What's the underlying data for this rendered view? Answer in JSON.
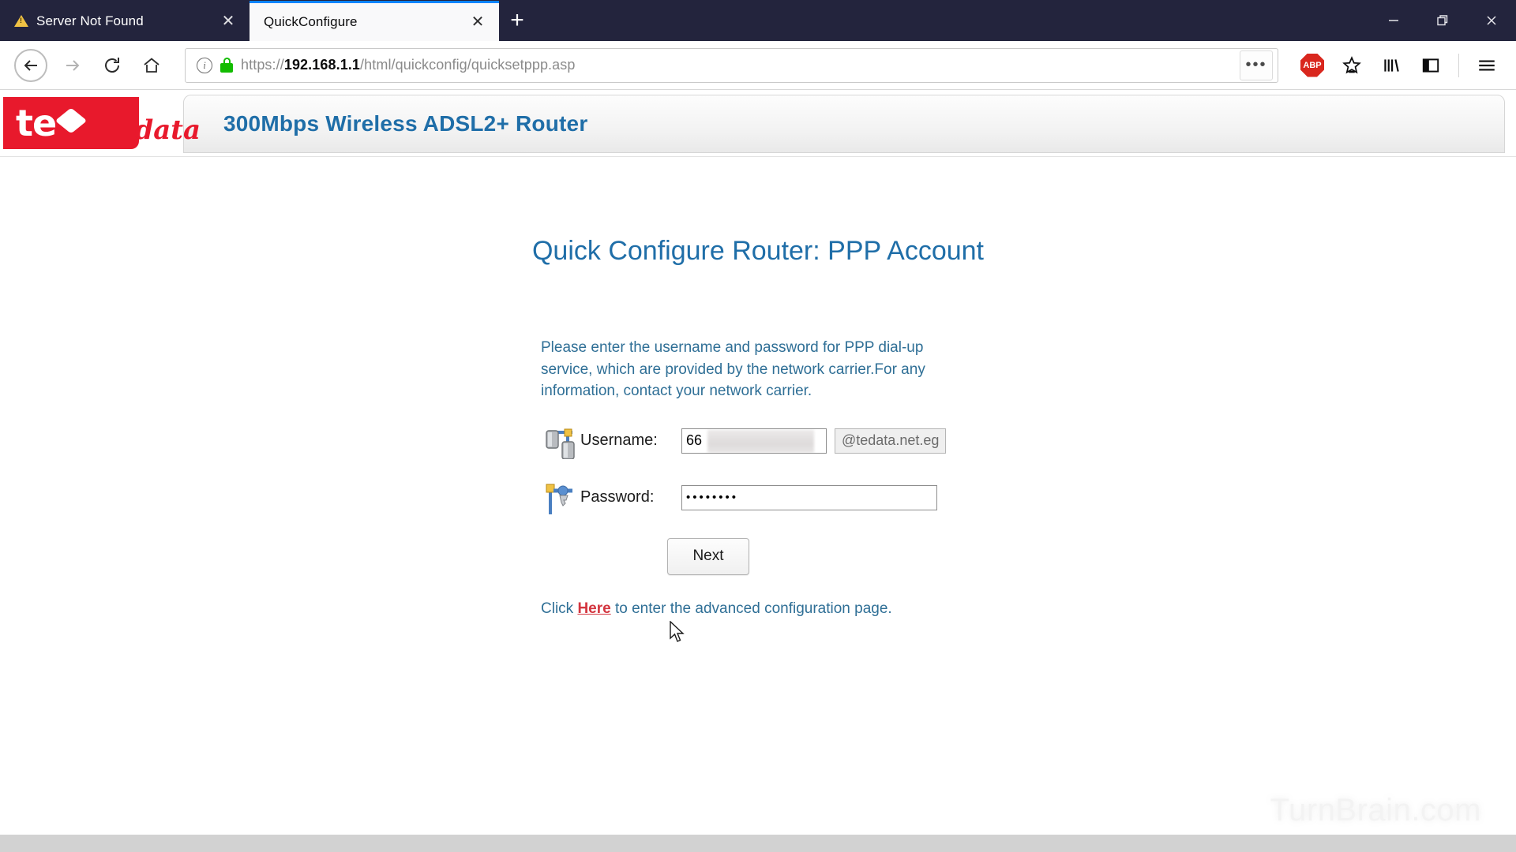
{
  "window": {
    "controls": [
      {
        "name": "minimize",
        "glyph": "minimize-icon"
      },
      {
        "name": "restore",
        "glyph": "restore-icon"
      },
      {
        "name": "close",
        "glyph": "close-icon"
      }
    ]
  },
  "tabs": [
    {
      "title": "Server Not Found",
      "active": false,
      "favicon": "warning-icon"
    },
    {
      "title": "QuickConfigure",
      "active": true,
      "favicon": "none"
    }
  ],
  "newtab_label": "+",
  "navigation": {
    "back": "←",
    "forward": "→",
    "reload": "⟳",
    "home": "⌂",
    "page_actions": "•••"
  },
  "address_bar": {
    "scheme": "https://",
    "host": "192.168.1.1",
    "path": "/html/quickconfig/quicksetppp.asp",
    "full_url": "https://192.168.1.1/html/quickconfig/quicksetppp.asp",
    "security": "secure",
    "info_glyph": "i"
  },
  "toolbar_icons": [
    {
      "name": "adblock-plus-icon",
      "label": "ABP"
    },
    {
      "name": "bookmark-star-icon",
      "label": ""
    },
    {
      "name": "library-icon",
      "label": ""
    },
    {
      "name": "sidebar-icon",
      "label": ""
    },
    {
      "name": "hamburger-menu-icon",
      "label": ""
    }
  ],
  "page": {
    "brand": {
      "logo_te": "te",
      "logo_data": "data"
    },
    "device_header": "300Mbps Wireless ADSL2+ Router",
    "title": "Quick Configure Router: PPP Account",
    "intro": "Please enter the username and password for PPP dial-up service, which are provided by the network carrier.For any information, contact your network carrier.",
    "fields": [
      {
        "id": "username",
        "label": "Username:",
        "value": "66",
        "suffix": "@tedata.net.eg",
        "icon": "network-users-icon",
        "redacted": true
      },
      {
        "id": "password",
        "label": "Password:",
        "value": "••••••••",
        "icon": "key-icon",
        "redacted": false
      }
    ],
    "next_button": "Next",
    "footnote": {
      "prefix": "Click ",
      "link": "Here",
      "suffix": " to enter the advanced configuration page."
    },
    "watermark": "TurnBrain.com"
  },
  "colors": {
    "chrome_dark": "#23243d",
    "active_tab_accent": "#0a84ff",
    "brand_red": "#e8192c",
    "heading_blue": "#1f6ea8",
    "body_blue": "#2f6f96",
    "link_red": "#d3353f",
    "lock_green": "#12bc00"
  }
}
